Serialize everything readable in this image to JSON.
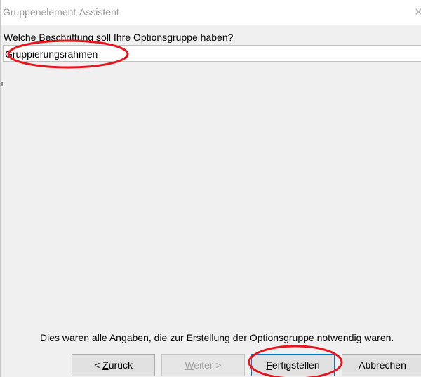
{
  "window": {
    "title": "Gruppenelement-Assistent",
    "close_glyph": "✕"
  },
  "prompt": {
    "question": "Welche Beschriftung soll Ihre Optionsgruppe haben?"
  },
  "caption_field": {
    "value": "Gruppierungsrahmen"
  },
  "footer": {
    "info": "Dies waren alle Angaben, die zur Erstellung der Optionsgruppe notwendig waren."
  },
  "buttons": {
    "back": {
      "prefix": "< ",
      "mnemonic": "Z",
      "rest": "urück"
    },
    "next": {
      "mnemonic": "W",
      "rest": "eiter >",
      "enabled": false
    },
    "finish": {
      "mnemonic": "F",
      "rest": "ertigstellen"
    },
    "cancel": {
      "label": "Abbrechen"
    }
  },
  "colors": {
    "annotation": "#e8141c",
    "focus_border": "#0078d7"
  }
}
